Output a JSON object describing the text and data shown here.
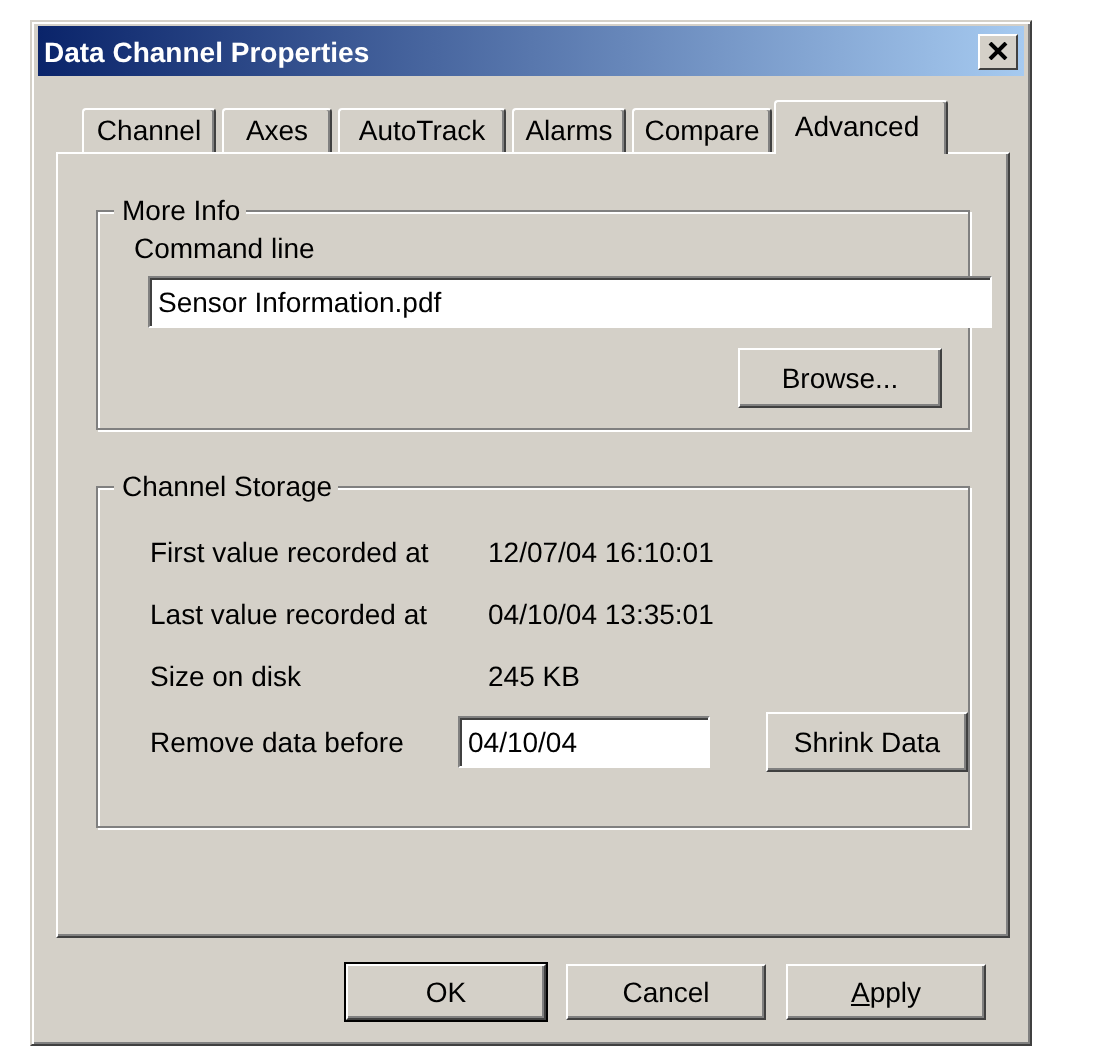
{
  "window": {
    "title": "Data Channel Properties"
  },
  "tabs": [
    {
      "label": "Channel",
      "selected": false
    },
    {
      "label": "Axes",
      "selected": false
    },
    {
      "label": "AutoTrack",
      "selected": false
    },
    {
      "label": "Alarms",
      "selected": false
    },
    {
      "label": "Compare",
      "selected": false
    },
    {
      "label": "Advanced",
      "selected": true
    }
  ],
  "more_info": {
    "title": "More Info",
    "command_line": {
      "label": "Command line",
      "value": "Sensor Information.pdf"
    },
    "browse_button": "Browse..."
  },
  "channel_storage": {
    "title": "Channel Storage",
    "rows": [
      {
        "label": "First value recorded at",
        "value": "12/07/04 16:10:01"
      },
      {
        "label": "Last value recorded at",
        "value": "04/10/04 13:35:01"
      },
      {
        "label": "Size on disk",
        "value": "245 KB"
      }
    ],
    "remove_before": {
      "label": "Remove data before",
      "value": "04/10/04",
      "button": "Shrink Data"
    }
  },
  "buttons": [
    {
      "label": "OK",
      "default": true,
      "mnemonic": false
    },
    {
      "label": "Cancel",
      "default": false,
      "mnemonic": false
    },
    {
      "label": "Apply",
      "default": false,
      "mnemonic": true
    }
  ]
}
